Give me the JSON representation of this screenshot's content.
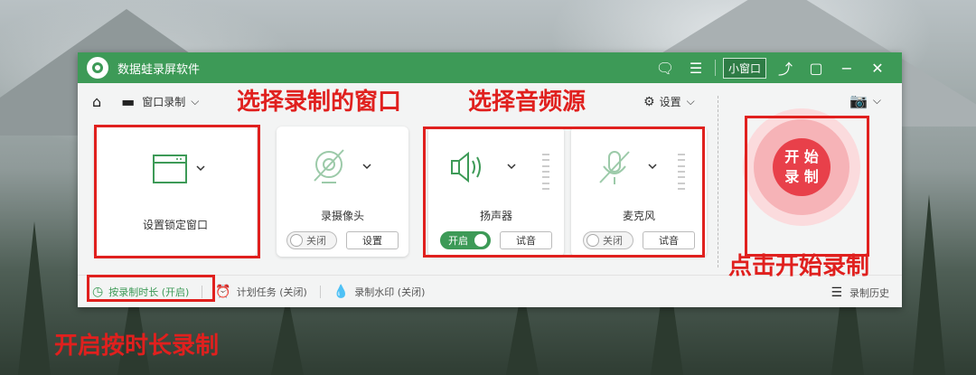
{
  "window": {
    "title": "数据蛙录屏软件",
    "mini_window_label": "小窗口",
    "accent_color": "#3d9a57"
  },
  "toolbar": {
    "home_icon": "home-icon",
    "mode_label": "窗口录制",
    "settings_label": "设置"
  },
  "cards": {
    "window": {
      "label": "设置锁定窗口"
    },
    "webcam": {
      "label": "录摄像头",
      "toggle_label": "关闭",
      "button_label": "设置"
    },
    "speaker": {
      "label": "扬声器",
      "toggle_label": "开启",
      "button_label": "试音"
    },
    "mic": {
      "label": "麦克风",
      "toggle_label": "关闭",
      "button_label": "试音"
    }
  },
  "record_button": {
    "line1": "开 始",
    "line2": "录 制"
  },
  "bottombar": {
    "duration_label": "按录制时长 (开启)",
    "schedule_label": "计划任务 (关闭)",
    "watermark_label": "录制水印 (关闭)",
    "history_label": "录制历史"
  },
  "annotations": {
    "select_window": "选择录制的窗口",
    "select_audio": "选择音频源",
    "click_start": "点击开始录制",
    "enable_duration": "开启按时长录制",
    "color": "#e0201e"
  }
}
